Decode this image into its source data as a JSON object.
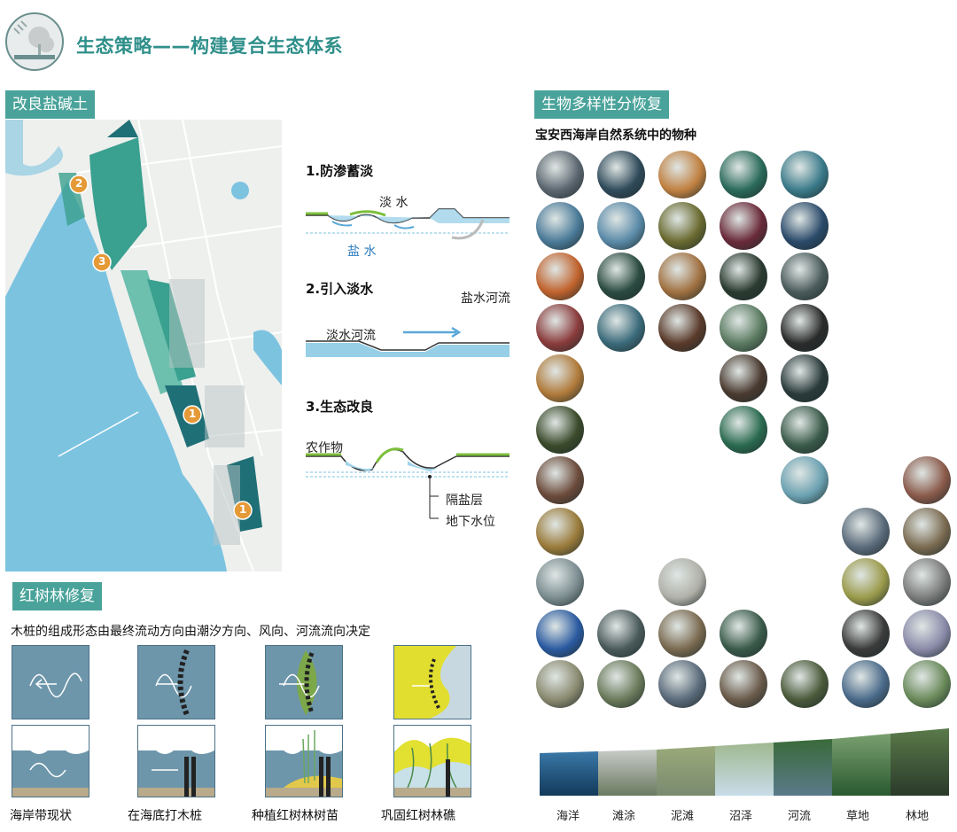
{
  "header": {
    "title": "生态策略——构建复合生态体系",
    "logo_icon": "tree-icon"
  },
  "sections": {
    "soil": "改良盐碱土",
    "biodiversity": "生物多样性分恢复",
    "mangrove": "红树林修复"
  },
  "map": {
    "markers": [
      "2",
      "3",
      "1",
      "1"
    ],
    "colors": {
      "sea": "#7cc3e0",
      "land": "#eef0ee",
      "green": "#3aa08f",
      "dark": "#1f6f76"
    }
  },
  "strategies": [
    {
      "title": "1.防渗蓄淡",
      "labels": [
        "淡 水",
        "盐 水"
      ]
    },
    {
      "title": "2.引入淡水",
      "labels": [
        "盐水河流",
        "淡水河流"
      ]
    },
    {
      "title": "3.生态改良",
      "labels": [
        "农作物",
        "隔盐层",
        "地下水位"
      ]
    }
  ],
  "species": {
    "title": "宝安西海岸自然系统中的物种",
    "columns": [
      {
        "name": "海洋",
        "colors": [
          "#5b6670",
          "#4a7a98",
          "#c0622c",
          "#8a3b3b",
          "#b07a3a",
          "#3a4a2a",
          "#6b4a3a",
          "#9a7a3a",
          "#7b8c90",
          "#2a5aa0",
          "#8a8a70"
        ]
      },
      {
        "name": "滩涂",
        "colors": [
          "#2f4a5a",
          "#5a8aa8",
          "#2a4a40",
          "#3a6a7a",
          "",
          "",
          "",
          "",
          "",
          "#4a5a5a",
          "#6a7a5a"
        ]
      },
      {
        "name": "泥滩",
        "colors": [
          "#c08040",
          "#6a6a30",
          "#a07040",
          "#5a3a2a",
          "",
          "",
          "",
          "",
          "#b0b0a8",
          "#7a6a50",
          "#5a6a7a"
        ]
      },
      {
        "name": "沼泽",
        "colors": [
          "#2a6a5a",
          "#6a2a3a",
          "#2a3a30",
          "#5a7a60",
          "#4a3a30",
          "#2a6a50",
          "",
          "",
          "",
          "#3a5a4a",
          "#6a5a4a"
        ]
      },
      {
        "name": "河流",
        "colors": [
          "#3a7a8a",
          "#2a4a6a",
          "#4a5a5a",
          "#2a2a2a",
          "#2a3a3a",
          "#3a5a4a",
          "#6aa0b0",
          "",
          "",
          "",
          "#4a5a3a"
        ]
      },
      {
        "name": "草地",
        "colors": [
          "",
          "",
          "",
          "",
          "",
          "",
          "",
          "#5a6a7a",
          "#9a9a4a",
          "#3a3a3a",
          "#4a6a8a"
        ]
      },
      {
        "name": "林地",
        "colors": [
          "",
          "",
          "",
          "",
          "",
          "",
          "#8a5a4a",
          "#7a6a50",
          "#7a7a7a",
          "#8a8aa8",
          "#6a8a5a"
        ]
      }
    ]
  },
  "habitats": [
    "海洋",
    "滩涂",
    "泥滩",
    "沼泽",
    "河流",
    "草地",
    "林地"
  ],
  "mangrove": {
    "description": "木桩的组成形态由最终流动方向由潮汐方向、风向、河流流向决定",
    "steps": [
      "海岸带现状",
      "在海底打木桩",
      "种植红树林树苗",
      "巩固红树林礁"
    ]
  }
}
